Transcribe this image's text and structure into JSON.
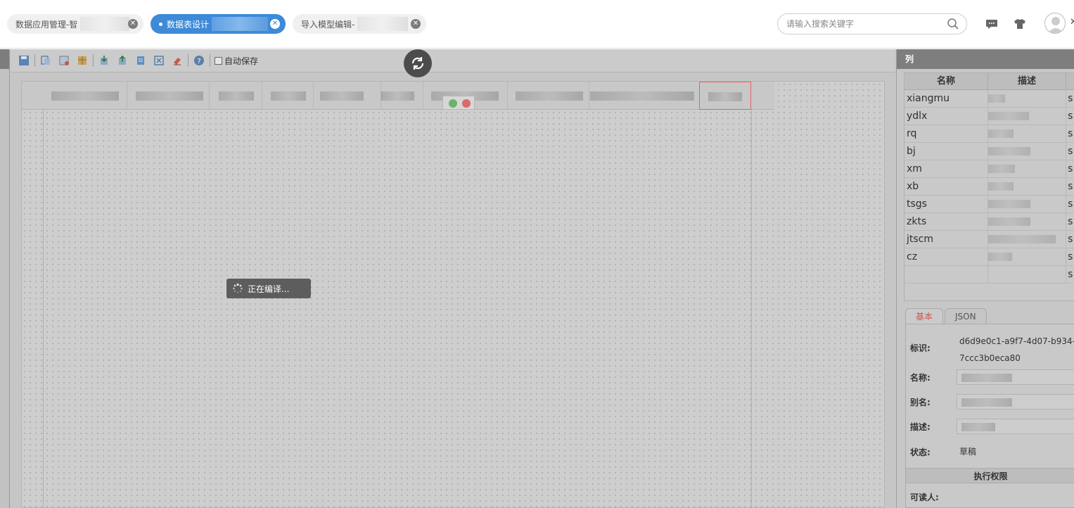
{
  "tabs": [
    {
      "label": "数据应用管理-智",
      "active": false
    },
    {
      "label": "数据表设计",
      "active": true
    },
    {
      "label": "导入模型编辑-",
      "active": false
    }
  ],
  "search": {
    "placeholder": "请输入搜索关键字"
  },
  "header_icons": [
    "message-icon",
    "shirt-icon",
    "user-avatar"
  ],
  "toolbar": {
    "autosave_label": "自动保存"
  },
  "loading": {
    "text": "正在编译..."
  },
  "columns_panel": {
    "title": "列",
    "headers": [
      "名称",
      "描述"
    ],
    "rows": [
      {
        "name": "xiangmu",
        "type": "s"
      },
      {
        "name": "ydlx",
        "type": "s"
      },
      {
        "name": "rq",
        "type": "s"
      },
      {
        "name": "bj",
        "type": "s"
      },
      {
        "name": "xm",
        "type": "s"
      },
      {
        "name": "xb",
        "type": "s"
      },
      {
        "name": "tsgs",
        "type": "s"
      },
      {
        "name": "zkts",
        "type": "s"
      },
      {
        "name": "jtscm",
        "type": "s"
      },
      {
        "name": "cz",
        "type": "s"
      },
      {
        "name": "",
        "type": "s"
      }
    ]
  },
  "props_panel": {
    "tabs": [
      "基本",
      "JSON"
    ],
    "id_label": "标识:",
    "id_value_line1": "d6d9e0c1-a9f7-4d07-b934-",
    "id_value_line2": "7ccc3b0eca80",
    "name_label": "名称:",
    "alias_label": "别名:",
    "desc_label": "描述:",
    "status_label": "状态:",
    "status_value": "草稿",
    "section_title": "执行权限",
    "readers_label": "可读人:"
  },
  "colors": {
    "accent": "#3d8ad9",
    "overlay": "#c6c6c6",
    "header_dark": "#7e7e7e"
  }
}
